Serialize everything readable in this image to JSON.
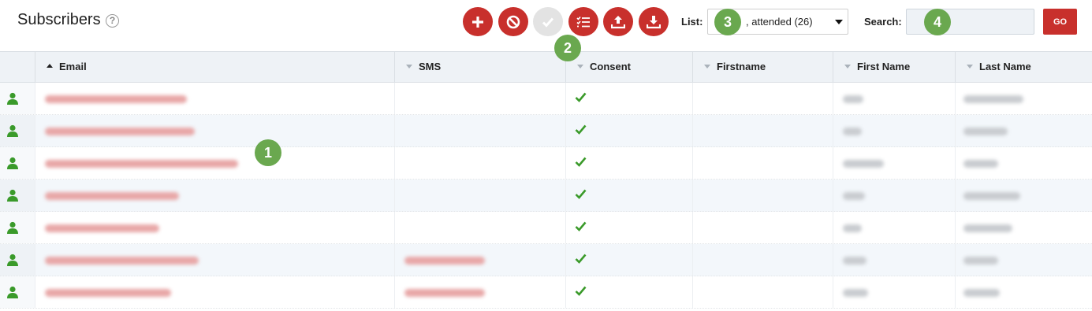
{
  "page_title": "Subscribers",
  "help_icon": "?",
  "toolbar": {
    "buttons": [
      {
        "icon": "plus-icon",
        "enabled": true
      },
      {
        "icon": "block-icon",
        "enabled": true
      },
      {
        "icon": "check-icon",
        "enabled": false
      },
      {
        "icon": "checklist-icon",
        "enabled": true
      },
      {
        "icon": "upload-icon",
        "enabled": true
      },
      {
        "icon": "download-icon",
        "enabled": true
      }
    ],
    "list_label": "List:",
    "list_value": ", attended (26)",
    "search_label": "Search:",
    "search_value": "",
    "go_label": "GO"
  },
  "badges": [
    "1",
    "2",
    "3",
    "4"
  ],
  "table": {
    "columns": [
      {
        "label": "Email",
        "sort": "asc"
      },
      {
        "label": "SMS",
        "sort": "none"
      },
      {
        "label": "Consent",
        "sort": "none"
      },
      {
        "label": "Firstname",
        "sort": "none"
      },
      {
        "label": "First Name",
        "sort": "none"
      },
      {
        "label": "Last Name",
        "sort": "none"
      }
    ],
    "rows": [
      {
        "consent": true,
        "has_sms": false
      },
      {
        "consent": true,
        "has_sms": false
      },
      {
        "consent": true,
        "has_sms": false
      },
      {
        "consent": true,
        "has_sms": false
      },
      {
        "consent": true,
        "has_sms": false
      },
      {
        "consent": true,
        "has_sms": true
      },
      {
        "consent": true,
        "has_sms": true
      }
    ]
  },
  "colors": {
    "accent": "#c8302c",
    "badge": "#6aa84f",
    "check": "#3a9a2a",
    "header_bg": "#eef2f6"
  }
}
